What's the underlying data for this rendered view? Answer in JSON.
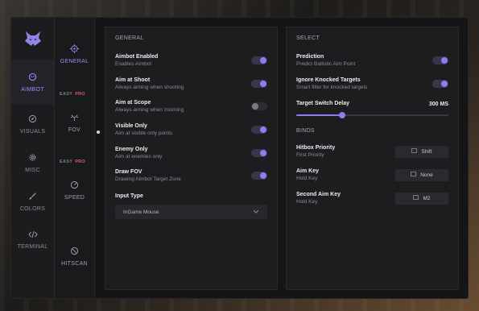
{
  "sidebar": {
    "items": [
      {
        "label": "AIMBOT",
        "icon": "crosshair-face-icon",
        "active": true
      },
      {
        "label": "VISUALS",
        "icon": "compass-icon"
      },
      {
        "label": "MISC",
        "icon": "gear-icon"
      },
      {
        "label": "COLORS",
        "icon": "brush-icon"
      },
      {
        "label": "TERMINAL",
        "icon": "code-icon"
      }
    ]
  },
  "subnav": {
    "items": [
      {
        "label": "GENERAL",
        "icon": "target-icon",
        "active": true
      },
      {
        "label": "FOV",
        "icon": "fov-icon"
      },
      {
        "label": "SPEED",
        "icon": "speed-gauge-icon"
      },
      {
        "label": "HITSCAN",
        "icon": "hitscan-icon"
      }
    ],
    "tag_easy": "EASY",
    "tag_pro": "PRO"
  },
  "general": {
    "title": "GENERAL",
    "rows": [
      {
        "title": "Aimbot Enabled",
        "sub": "Enables Aimbot",
        "on": true
      },
      {
        "title": "Aim at Shoot",
        "sub": "Always aiming when shooting",
        "on": true
      },
      {
        "title": "Aim at Scope",
        "sub": "Always aiming when zooming",
        "on": false
      },
      {
        "title": "Visible Only",
        "sub": "Aim at visible only points",
        "on": true
      },
      {
        "title": "Enemy Only",
        "sub": "Aim at enemies only",
        "on": true
      },
      {
        "title": "Draw FOV",
        "sub": "Drawing Aimbot Target Zone",
        "on": true
      }
    ],
    "input_type_label": "Input Type",
    "input_type_value": "InGame Mouse"
  },
  "select": {
    "title": "SELECT",
    "rows": [
      {
        "title": "Prediction",
        "sub": "Predict Ballistic Aim Point",
        "on": true
      },
      {
        "title": "Ignore Knocked Targets",
        "sub": "Smart filter for knocked targets",
        "on": true
      }
    ],
    "delay_label": "Target Switch Delay",
    "delay_value": "300 MS",
    "delay_fraction": 0.3
  },
  "binds": {
    "title": "BINDS",
    "rows": [
      {
        "title": "Hitbox Priority",
        "sub": "First Priority",
        "key": "Shift"
      },
      {
        "title": "Aim Key",
        "sub": "Hold Key",
        "key": "None"
      },
      {
        "title": "Second Aim Key",
        "sub": "Hold Key",
        "key": "M2"
      }
    ]
  },
  "colors": {
    "accent": "#8b7ff0",
    "pro": "#e05a6a",
    "panel": "#1d1d20"
  }
}
